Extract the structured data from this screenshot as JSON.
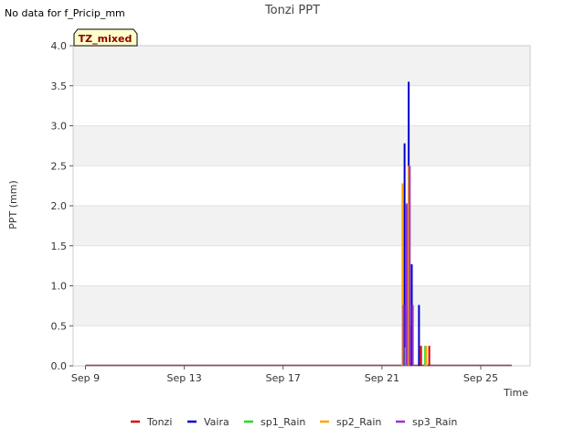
{
  "header": {
    "no_data_note": "No data for f_Pricip_mm",
    "badge": "TZ_mixed"
  },
  "chart_data": {
    "type": "bar",
    "title": "Tonzi PPT",
    "xlabel": "Time",
    "ylabel": "PPT (mm)",
    "x_range": [
      "2023-09-08 12:00",
      "2023-09-27 00:00"
    ],
    "x_ticks": [
      {
        "date": "2023-09-09",
        "label": "Sep 9"
      },
      {
        "date": "2023-09-13",
        "label": "Sep 13"
      },
      {
        "date": "2023-09-17",
        "label": "Sep 17"
      },
      {
        "date": "2023-09-21",
        "label": "Sep 21"
      },
      {
        "date": "2023-09-25",
        "label": "Sep 25"
      }
    ],
    "ylim": [
      0,
      4.0
    ],
    "y_ticks": [
      "0.0",
      "0.5",
      "1.0",
      "1.5",
      "2.0",
      "2.5",
      "3.0",
      "3.5",
      "4.0"
    ],
    "grid": "horizontal bands",
    "legend_position": "bottom",
    "baseline_range": [
      "2023-09-09 00:00",
      "2023-09-26 06:00"
    ],
    "series": [
      {
        "name": "Tonzi",
        "color": "#dd0000",
        "points": [
          [
            "2023-09-21 21:00",
            0.2
          ],
          [
            "2023-09-22 00:00",
            2.0
          ],
          [
            "2023-09-22 03:00",
            0.5
          ],
          [
            "2023-09-22 14:00",
            0.25
          ],
          [
            "2023-09-22 22:00",
            0.25
          ]
        ]
      },
      {
        "name": "Vaira",
        "color": "#0000cc",
        "points": [
          [
            "2023-09-21 22:00",
            2.78
          ],
          [
            "2023-09-22 02:00",
            3.55
          ],
          [
            "2023-09-22 05:00",
            1.27
          ],
          [
            "2023-09-22 12:00",
            0.76
          ]
        ]
      },
      {
        "name": "sp1_Rain",
        "color": "#22dd22",
        "points": [
          [
            "2023-09-21 23:00",
            0.23
          ],
          [
            "2023-09-22 18:00",
            0.25
          ]
        ]
      },
      {
        "name": "sp2_Rain",
        "color": "#ffa500",
        "points": [
          [
            "2023-09-21 20:00",
            2.28
          ],
          [
            "2023-09-22 02:00",
            2.5
          ],
          [
            "2023-09-22 19:00",
            0.25
          ]
        ]
      },
      {
        "name": "sp3_Rain",
        "color": "#9933cc",
        "points": [
          [
            "2023-09-21 21:00",
            0.76
          ],
          [
            "2023-09-22 00:00",
            2.03
          ],
          [
            "2023-09-22 03:00",
            2.5
          ],
          [
            "2023-09-22 06:00",
            0.76
          ]
        ]
      }
    ]
  }
}
